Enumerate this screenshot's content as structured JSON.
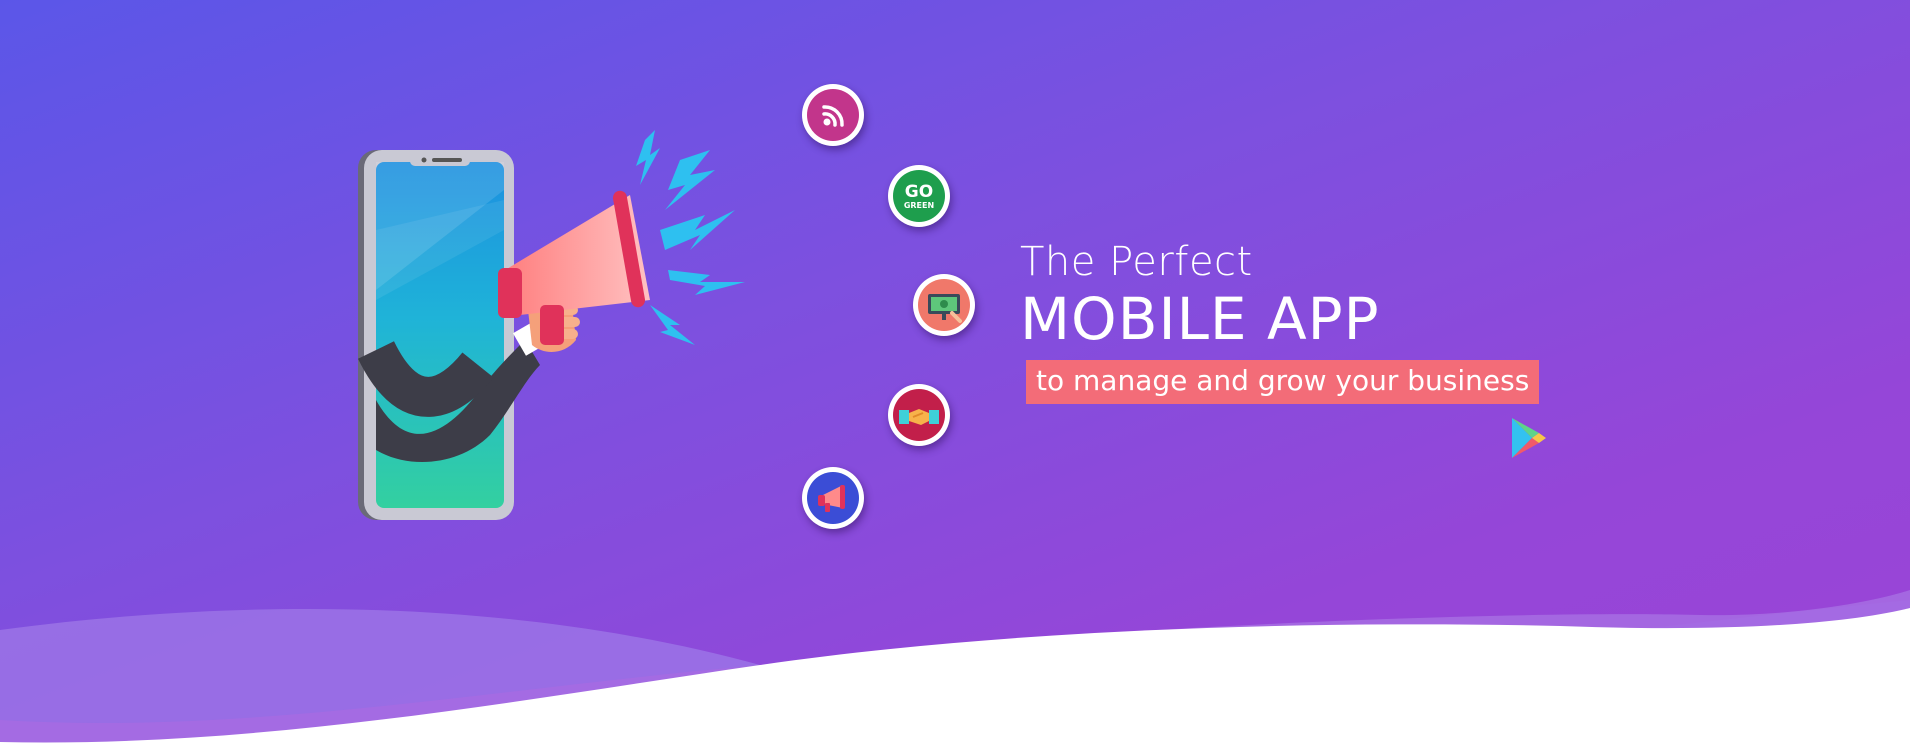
{
  "hero": {
    "tagline_small": "The Perfect",
    "tagline_big": "MOBILE APP",
    "tagline_highlight": "to manage and grow your business",
    "text_color": "#ffffff",
    "highlight_color": "#f36c78",
    "gradient_start": "#5b56e8",
    "gradient_end": "#9a44d6"
  },
  "features": [
    {
      "icon": "wifi-signal-icon",
      "color": "#c2358b"
    },
    {
      "icon": "go-green-icon",
      "label_top": "GO",
      "label_bottom": "GREEN",
      "color": "#1e9e4d"
    },
    {
      "icon": "money-screen-icon",
      "color": "#f0786a"
    },
    {
      "icon": "handshake-icon",
      "color": "#c21f4a"
    },
    {
      "icon": "megaphone-icon",
      "color": "#3b4dd6"
    }
  ],
  "store": {
    "icon": "google-play-icon"
  }
}
